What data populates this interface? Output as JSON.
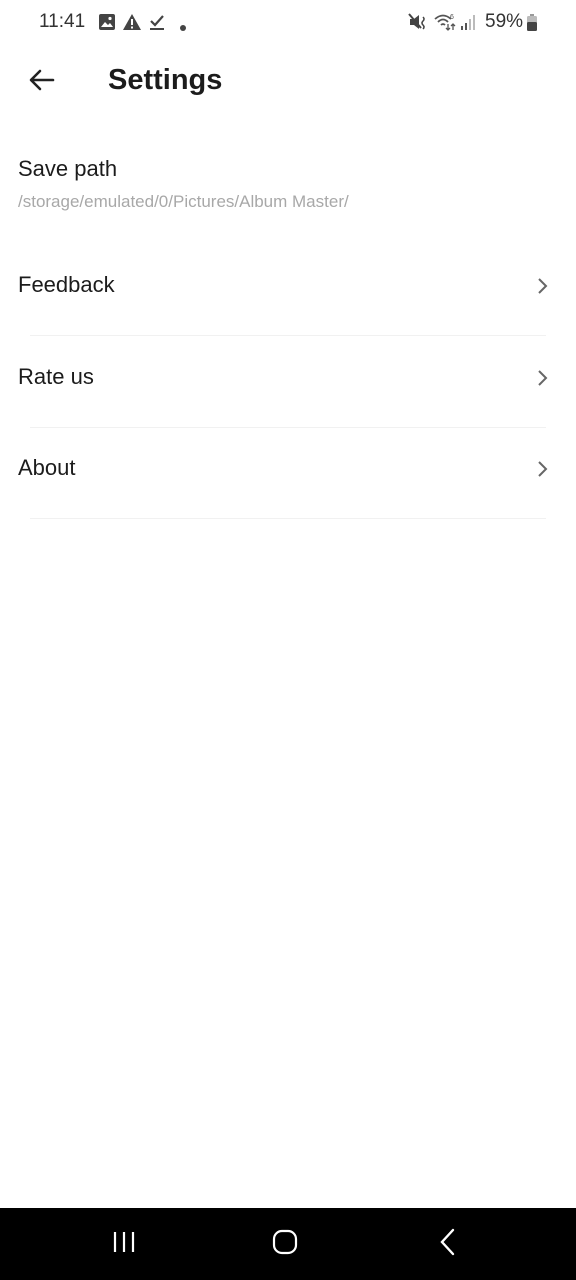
{
  "status_bar": {
    "time": "11:41",
    "left_icons": [
      "gallery-notification-icon",
      "warning-icon",
      "task-done-icon",
      "more-notifications-dot"
    ],
    "right_icons": [
      "mute-vibrate-icon",
      "wifi-6-icon",
      "signal-icon",
      "battery-icon"
    ],
    "battery_percent": "59%"
  },
  "app_bar": {
    "title": "Settings",
    "back_icon": "arrow-left-icon"
  },
  "save_path": {
    "title": "Save path",
    "value": "/storage/emulated/0/Pictures/Album Master/"
  },
  "menu": {
    "items": [
      {
        "label": "Feedback",
        "icon": "chevron-right-icon"
      },
      {
        "label": "Rate us",
        "icon": "chevron-right-icon"
      },
      {
        "label": "About",
        "icon": "chevron-right-icon"
      }
    ]
  },
  "nav_bar": {
    "buttons": [
      "recent-apps",
      "home",
      "back"
    ]
  },
  "colors": {
    "background": "#ffffff",
    "text_primary": "#1c1c1c",
    "text_secondary": "#a8a8a8",
    "divider": "#f1f1f1",
    "nav_bar": "#000000"
  }
}
